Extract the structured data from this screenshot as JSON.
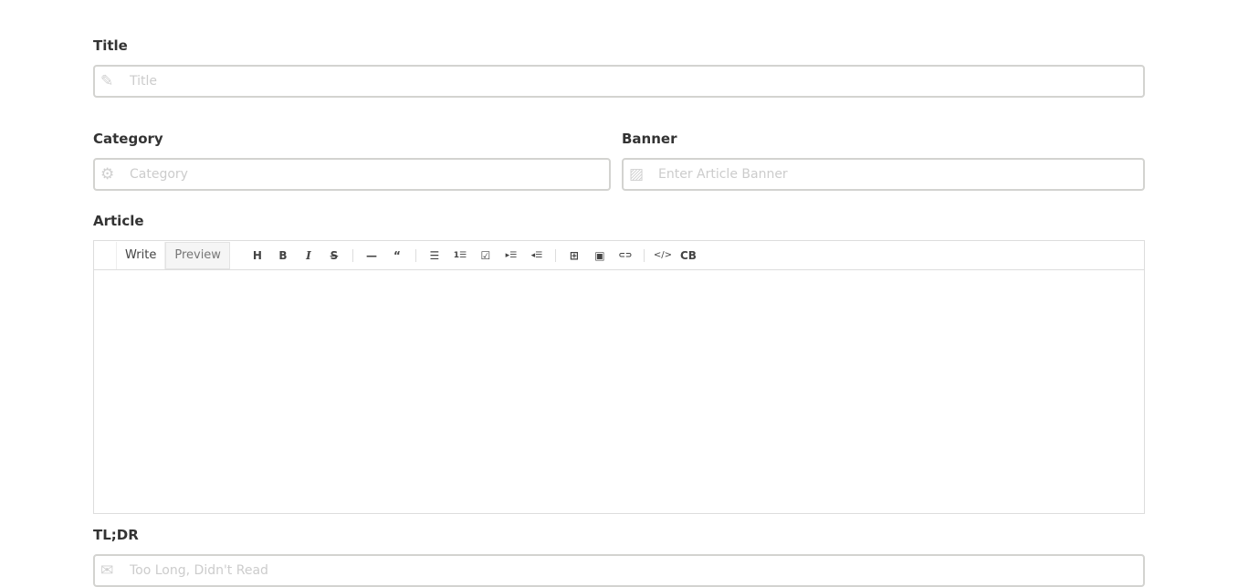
{
  "title": {
    "label": "Title",
    "placeholder": "Title"
  },
  "category": {
    "label": "Category",
    "placeholder": "Category"
  },
  "banner": {
    "label": "Banner",
    "placeholder": "Enter Article Banner"
  },
  "article": {
    "label": "Article",
    "tabs": {
      "write": "Write",
      "preview": "Preview"
    },
    "toolbar": [
      "H",
      "B",
      "I",
      "S",
      "—",
      "“",
      "☰",
      "1☰",
      "☑",
      "▸☰",
      "◂☰",
      "⊞",
      "▣",
      "⊂⊃",
      "</>",
      "CB"
    ]
  },
  "tldr": {
    "label": "TL;DR",
    "placeholder": "Too Long, Didn't Read"
  }
}
